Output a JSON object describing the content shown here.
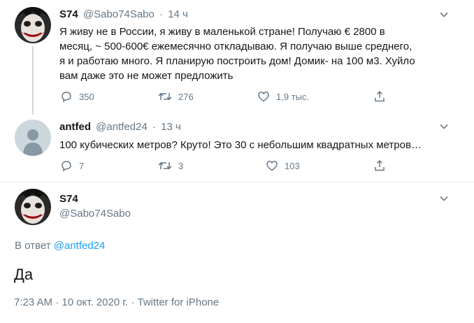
{
  "tweet1": {
    "name": "S74",
    "handle": "@Sabo74Sabo",
    "sep": "·",
    "time": "14 ч",
    "lines": [
      "Я живу не в России, я живу в маленькой стране! Получаю € 2800 в",
      "месяц, ~ 500-600€ ежемесячно откладываю. Я получаю выше среднего,",
      "я и работаю много. Я планирую построить дом! Домик- на 100 м3. Хуйло",
      "вам даже это не может предложить"
    ],
    "replies": "350",
    "retweets": "276",
    "likes": "1,9 тыс."
  },
  "tweet2": {
    "name": "antfed",
    "handle": "@antfed24",
    "sep": "·",
    "time": "13 ч",
    "text": "100 кубических метров? Круто! Это 30 с небольшим квадратных метров…",
    "replies": "7",
    "retweets": "3",
    "likes": "103"
  },
  "tweet3": {
    "name": "S74",
    "handle": "@Sabo74Sabo",
    "replying_prefix": "В ответ",
    "replying_to": "@antfed24",
    "text": "Да",
    "meta": "7:23 AM · 10 окт. 2020 г. · Twitter for iPhone"
  },
  "colors": {
    "text": "#14171a",
    "secondary": "#657786",
    "link": "#1da1f2",
    "line": "#cfd9de"
  },
  "icons": [
    "joker-avatar",
    "default-avatar",
    "chevron-down-icon",
    "reply-icon",
    "retweet-icon",
    "like-icon",
    "share-icon"
  ]
}
